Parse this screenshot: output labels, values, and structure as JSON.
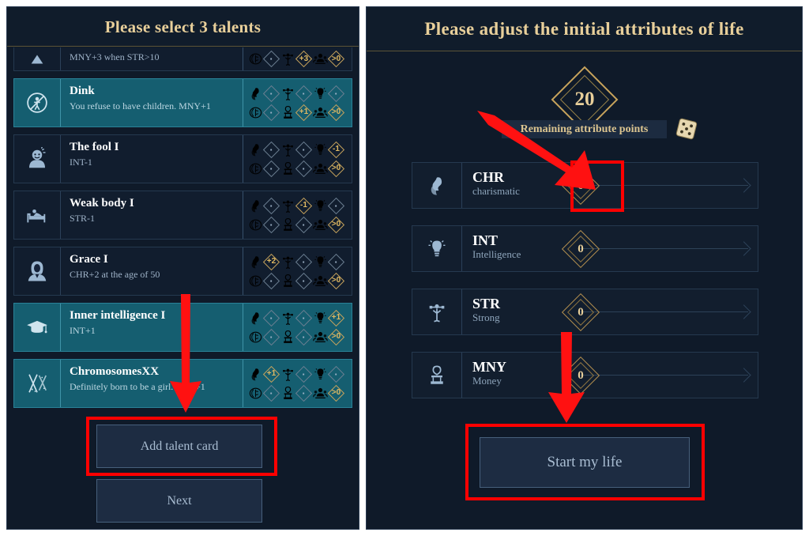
{
  "left_panel": {
    "title": "Please select 3 talents",
    "talents": [
      {
        "name": "",
        "desc": "MNY+3 when STR>10",
        "icon": "mountain-icon",
        "selected": false,
        "partial": true,
        "stats_top": [
          {
            "icon": "brain-cloud-icon",
            "value": "·",
            "highlight": false
          },
          {
            "icon": "strength-icon",
            "value": "+3",
            "highlight": true
          },
          {
            "icon": "crowd-icon",
            "value": ">0",
            "highlight": true
          }
        ],
        "stats_bottom": []
      },
      {
        "name": "Dink",
        "desc": "You refuse to have children. MNY+1",
        "icon": "no-children-icon",
        "selected": true,
        "partial": false,
        "stats_top": [
          {
            "icon": "charisma-icon",
            "value": "·",
            "highlight": false
          },
          {
            "icon": "strength-icon",
            "value": "·",
            "highlight": false
          },
          {
            "icon": "intelligence-icon",
            "value": "·",
            "highlight": false
          }
        ],
        "stats_bottom": [
          {
            "icon": "brain-icon",
            "value": "·",
            "highlight": false
          },
          {
            "icon": "money-icon",
            "value": "+1",
            "highlight": true
          },
          {
            "icon": "crowd-icon",
            "value": ">0",
            "highlight": true
          }
        ]
      },
      {
        "name": "The fool I",
        "desc": "INT-1",
        "icon": "fool-face-icon",
        "selected": false,
        "partial": false,
        "stats_top": [
          {
            "icon": "charisma-icon",
            "value": "·",
            "highlight": false
          },
          {
            "icon": "strength-icon",
            "value": "·",
            "highlight": false
          },
          {
            "icon": "intelligence-icon",
            "value": "-1",
            "highlight": true
          }
        ],
        "stats_bottom": [
          {
            "icon": "brain-icon",
            "value": "·",
            "highlight": false
          },
          {
            "icon": "money-icon",
            "value": "·",
            "highlight": false
          },
          {
            "icon": "crowd-icon",
            "value": ">0",
            "highlight": true
          }
        ]
      },
      {
        "name": "Weak body I",
        "desc": "STR-1",
        "icon": "bed-icon",
        "selected": false,
        "partial": false,
        "stats_top": [
          {
            "icon": "charisma-icon",
            "value": "·",
            "highlight": false
          },
          {
            "icon": "strength-icon",
            "value": "-1",
            "highlight": true
          },
          {
            "icon": "intelligence-icon",
            "value": "·",
            "highlight": false
          }
        ],
        "stats_bottom": [
          {
            "icon": "brain-icon",
            "value": "·",
            "highlight": false
          },
          {
            "icon": "money-icon",
            "value": "·",
            "highlight": false
          },
          {
            "icon": "crowd-icon",
            "value": ">0",
            "highlight": true
          }
        ]
      },
      {
        "name": "Grace I",
        "desc": "CHR+2 at the age of 50",
        "icon": "elegant-woman-icon",
        "selected": false,
        "partial": false,
        "stats_top": [
          {
            "icon": "charisma-icon",
            "value": "+2",
            "highlight": true
          },
          {
            "icon": "strength-icon",
            "value": "·",
            "highlight": false
          },
          {
            "icon": "intelligence-icon",
            "value": "·",
            "highlight": false
          }
        ],
        "stats_bottom": [
          {
            "icon": "brain-icon",
            "value": "·",
            "highlight": false
          },
          {
            "icon": "money-icon",
            "value": "·",
            "highlight": false
          },
          {
            "icon": "crowd-icon",
            "value": ">0",
            "highlight": true
          }
        ]
      },
      {
        "name": "Inner intelligence I",
        "desc": "INT+1",
        "icon": "graduation-cap-icon",
        "selected": true,
        "partial": false,
        "stats_top": [
          {
            "icon": "charisma-icon",
            "value": "·",
            "highlight": false
          },
          {
            "icon": "strength-icon",
            "value": "·",
            "highlight": false
          },
          {
            "icon": "intelligence-icon",
            "value": "+1",
            "highlight": true
          }
        ],
        "stats_bottom": [
          {
            "icon": "brain-icon",
            "value": "·",
            "highlight": false
          },
          {
            "icon": "money-icon",
            "value": "·",
            "highlight": false
          },
          {
            "icon": "crowd-icon",
            "value": ">0",
            "highlight": true
          }
        ]
      },
      {
        "name": "ChromosomesXX",
        "desc": "Definitely born to be a girl. CHR+1",
        "icon": "chromosome-icon",
        "selected": true,
        "partial": false,
        "stats_top": [
          {
            "icon": "charisma-icon",
            "value": "+1",
            "highlight": true
          },
          {
            "icon": "strength-icon",
            "value": "·",
            "highlight": false
          },
          {
            "icon": "intelligence-icon",
            "value": "·",
            "highlight": false
          }
        ],
        "stats_bottom": [
          {
            "icon": "brain-icon",
            "value": "·",
            "highlight": false
          },
          {
            "icon": "money-icon",
            "value": "·",
            "highlight": false
          },
          {
            "icon": "crowd-icon",
            "value": ">0",
            "highlight": true
          }
        ]
      }
    ],
    "add_talent_label": "Add talent card",
    "next_label": "Next"
  },
  "right_panel": {
    "title": "Please adjust the initial attributes of life",
    "remaining_points": "20",
    "remaining_points_label": "Remaining attribute points",
    "dice_icon": "dice-icon",
    "attributes": [
      {
        "abbr": "CHR",
        "full": "charismatic",
        "value": "0",
        "icon": "charisma-icon"
      },
      {
        "abbr": "INT",
        "full": "Intelligence",
        "value": "0",
        "icon": "intelligence-icon"
      },
      {
        "abbr": "STR",
        "full": "Strong",
        "value": "0",
        "icon": "strength-icon"
      },
      {
        "abbr": "MNY",
        "full": "Money",
        "value": "0",
        "icon": "money-icon"
      }
    ],
    "start_label": "Start my life"
  },
  "annotations": {
    "accent_red": "#ff0000",
    "gold": "#e8cf9a",
    "teal_selected": "#155e70",
    "panel_bg": "#0f1a29"
  }
}
